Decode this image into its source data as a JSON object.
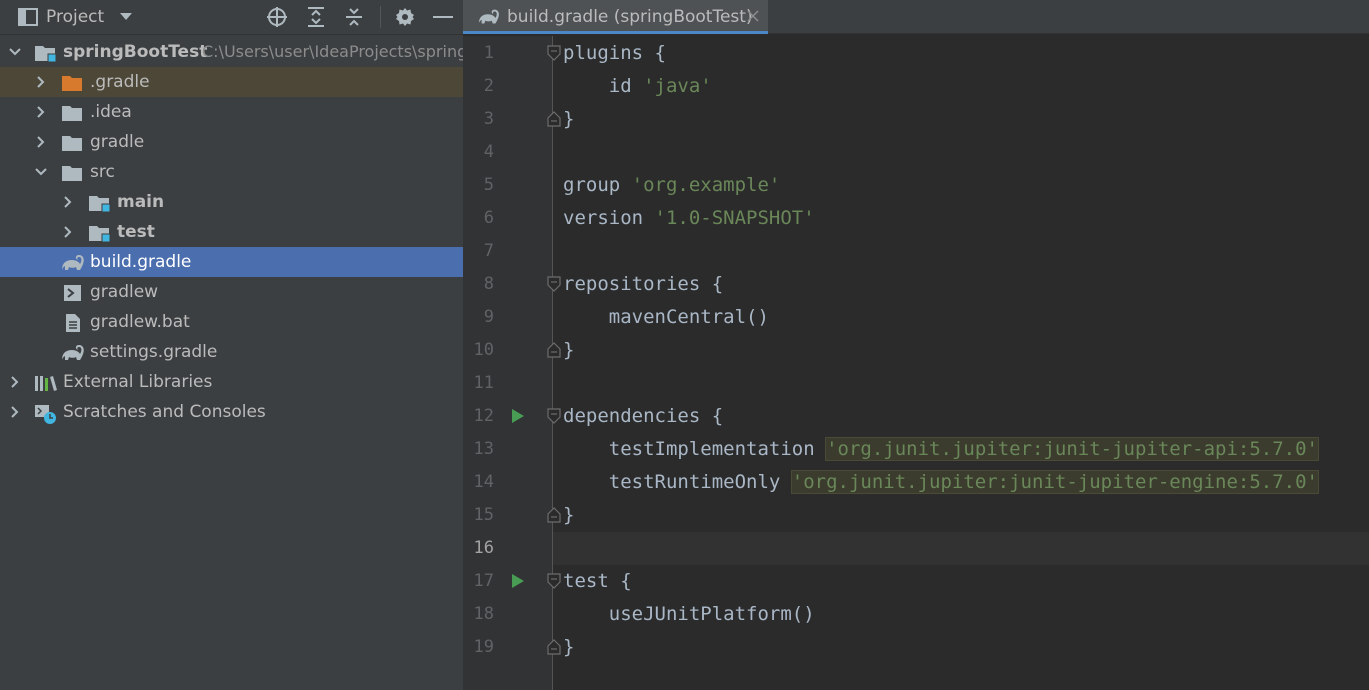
{
  "project_panel": {
    "title": "Project",
    "toolbar_icons": [
      "dropdown-icon",
      "locate-icon",
      "expand-all-icon",
      "collapse-all-icon",
      "gear-icon",
      "minimize-icon"
    ],
    "tree": [
      {
        "label": "springBootTest",
        "path": "C:\\Users\\user\\IdeaProjects\\springBootTest",
        "expanded": true,
        "bold": true
      },
      {
        "label": ".gradle",
        "expanded": false
      },
      {
        "label": ".idea",
        "expanded": false
      },
      {
        "label": "gradle",
        "expanded": false
      },
      {
        "label": "src",
        "expanded": true
      },
      {
        "label": "main",
        "expanded": false,
        "bold": true
      },
      {
        "label": "test",
        "expanded": false,
        "bold": true
      },
      {
        "label": "build.gradle",
        "selected": true
      },
      {
        "label": "gradlew"
      },
      {
        "label": "gradlew.bat"
      },
      {
        "label": "settings.gradle"
      },
      {
        "label": "External Libraries",
        "expanded": false
      },
      {
        "label": "Scratches and Consoles",
        "expanded": false
      }
    ]
  },
  "editor": {
    "tab": {
      "title": "build.gradle (springBootTest)"
    },
    "current_line": 16,
    "lines": [
      {
        "num": "1",
        "segments": [
          {
            "t": "plugins {",
            "c": "plain"
          }
        ]
      },
      {
        "num": "2",
        "segments": [
          {
            "t": "    id ",
            "c": "plain"
          },
          {
            "t": "'java'",
            "c": "str"
          }
        ]
      },
      {
        "num": "3",
        "segments": [
          {
            "t": "}",
            "c": "plain"
          }
        ]
      },
      {
        "num": "4",
        "segments": []
      },
      {
        "num": "5",
        "segments": [
          {
            "t": "group ",
            "c": "plain"
          },
          {
            "t": "'org.example'",
            "c": "str"
          }
        ]
      },
      {
        "num": "6",
        "segments": [
          {
            "t": "version ",
            "c": "plain"
          },
          {
            "t": "'1.0-SNAPSHOT'",
            "c": "str"
          }
        ]
      },
      {
        "num": "7",
        "segments": []
      },
      {
        "num": "8",
        "segments": [
          {
            "t": "repositories {",
            "c": "plain"
          }
        ]
      },
      {
        "num": "9",
        "segments": [
          {
            "t": "    mavenCentral()",
            "c": "plain"
          }
        ]
      },
      {
        "num": "10",
        "segments": [
          {
            "t": "}",
            "c": "plain"
          }
        ]
      },
      {
        "num": "11",
        "segments": []
      },
      {
        "num": "12",
        "segments": [
          {
            "t": "dependencies {",
            "c": "plain"
          }
        ]
      },
      {
        "num": "13",
        "segments": [
          {
            "t": "    testImplementation ",
            "c": "plain"
          },
          {
            "t": "'org.junit.jupiter:junit-jupiter-api:5.7.0'",
            "c": "hl"
          }
        ]
      },
      {
        "num": "14",
        "segments": [
          {
            "t": "    testRuntimeOnly ",
            "c": "plain"
          },
          {
            "t": "'org.junit.jupiter:junit-jupiter-engine:5.7.0'",
            "c": "hl"
          }
        ]
      },
      {
        "num": "15",
        "segments": [
          {
            "t": "}",
            "c": "plain"
          }
        ]
      },
      {
        "num": "16",
        "segments": []
      },
      {
        "num": "17",
        "segments": [
          {
            "t": "test {",
            "c": "plain"
          }
        ]
      },
      {
        "num": "18",
        "segments": [
          {
            "t": "    useJUnitPlatform()",
            "c": "plain"
          }
        ]
      },
      {
        "num": "19",
        "segments": [
          {
            "t": "}",
            "c": "plain"
          }
        ]
      }
    ],
    "run_gutter_lines": [
      12,
      17
    ],
    "fold_lines": [
      1,
      3,
      8,
      10,
      12,
      15,
      17,
      19
    ]
  },
  "colors": {
    "panel_bg": "#3c3f41",
    "editor_bg": "#2b2b2b",
    "selection": "#4b6eaf",
    "string": "#6a8759",
    "text": "#a9b7c6",
    "folder": "#aeb9c0",
    "excluded_folder": "#d87a2d",
    "source_marker": "#40b6e0",
    "run_green": "#499c54"
  }
}
